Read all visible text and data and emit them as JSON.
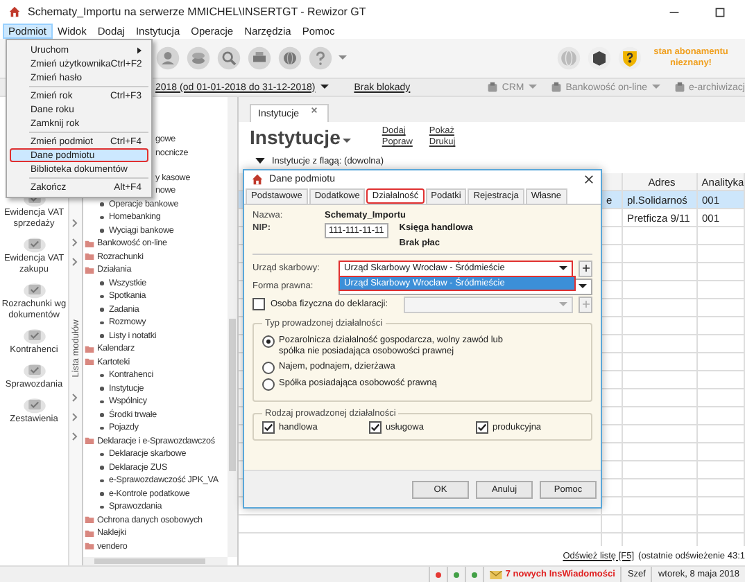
{
  "window": {
    "title": "Schematy_Importu na serwerze MMICHEL\\INSERTGT - Rewizor GT"
  },
  "menu_bar": [
    {
      "label": "Podmiot",
      "selected": true
    },
    {
      "label": "Widok",
      "selected": false
    },
    {
      "label": "Dodaj",
      "selected": false
    },
    {
      "label": "Instytucja",
      "selected": false
    },
    {
      "label": "Operacje",
      "selected": false
    },
    {
      "label": "Narzędzia",
      "selected": false
    },
    {
      "label": "Pomoc",
      "selected": false
    }
  ],
  "podmiot_menu": {
    "items": [
      {
        "kind": "item",
        "label": "Uruchom",
        "submenu": true,
        "selected": false,
        "highlighted": false
      },
      {
        "kind": "item",
        "label": "Zmień użytkownika",
        "shortcut": "Ctrl+F2",
        "submenu": false,
        "selected": false,
        "highlighted": false
      },
      {
        "kind": "item",
        "label": "Zmień hasło",
        "submenu": false,
        "selected": false,
        "highlighted": false
      },
      {
        "kind": "separator"
      },
      {
        "kind": "item",
        "label": "Zmień rok",
        "shortcut": "Ctrl+F3",
        "submenu": false,
        "selected": false,
        "highlighted": false
      },
      {
        "kind": "item",
        "label": "Dane roku",
        "submenu": false,
        "selected": false,
        "highlighted": false
      },
      {
        "kind": "item",
        "label": "Zamknij rok",
        "submenu": false,
        "selected": false,
        "highlighted": false
      },
      {
        "kind": "separator"
      },
      {
        "kind": "item",
        "label": "Zmień podmiot",
        "shortcut": "Ctrl+F4",
        "submenu": false,
        "selected": false,
        "highlighted": false
      },
      {
        "kind": "item",
        "label": "Dane podmiotu",
        "submenu": false,
        "selected": true,
        "highlighted": true
      },
      {
        "kind": "item",
        "label": "Biblioteka dokumentów",
        "submenu": false,
        "selected": false,
        "highlighted": false
      },
      {
        "kind": "separator"
      },
      {
        "kind": "item",
        "label": "Zakończ",
        "shortcut": "Alt+F4",
        "submenu": false,
        "selected": false,
        "highlighted": false
      }
    ]
  },
  "toolbar": {
    "subscription": "stan abonamentu nieznany!"
  },
  "period_bar": {
    "period": "2018 (od 01-01-2018 do 31-12-2018)",
    "lock": "Brak blokady",
    "modules": [
      {
        "label": "CRM",
        "dropdown": true
      },
      {
        "label": "Bankowość on-line",
        "dropdown": true
      },
      {
        "label": "e-archiwizacj",
        "dropdown": false
      }
    ]
  },
  "shortcuts": [
    "Ewidencja VAT sprzedaży",
    "Ewidencja VAT zakupu",
    "Rozrachunki wg dokumentów",
    "Kontrahenci",
    "Sprawozdania",
    "Zestawienia"
  ],
  "module_list_label": "Lista modułów",
  "module_tree": [
    {
      "kind": "partial",
      "label": "gowe"
    },
    {
      "kind": "partial",
      "label": "nocnicze"
    },
    {
      "kind": "partial",
      "label": "y kasowe"
    },
    {
      "kind": "partial",
      "label": "nowe"
    },
    {
      "kind": "leaf",
      "label": "Operacje bankowe"
    },
    {
      "kind": "leaf",
      "label": "Homebanking"
    },
    {
      "kind": "leaf",
      "label": "Wyciągi bankowe"
    },
    {
      "kind": "group",
      "label": "Bankowość on-line"
    },
    {
      "kind": "group",
      "label": "Rozrachunki"
    },
    {
      "kind": "group",
      "label": "Działania",
      "children": [
        {
          "kind": "leaf",
          "label": "Wszystkie"
        },
        {
          "kind": "leaf",
          "label": "Spotkania"
        },
        {
          "kind": "leaf",
          "label": "Zadania"
        },
        {
          "kind": "leaf",
          "label": "Rozmowy"
        },
        {
          "kind": "leaf",
          "label": "Listy i notatki"
        }
      ]
    },
    {
      "kind": "group",
      "label": "Kalendarz"
    },
    {
      "kind": "group",
      "label": "Kartoteki",
      "children": [
        {
          "kind": "leaf",
          "label": "Kontrahenci"
        },
        {
          "kind": "leaf",
          "label": "Instytucje"
        },
        {
          "kind": "leaf",
          "label": "Wspólnicy"
        },
        {
          "kind": "leaf",
          "label": "Środki trwałe"
        },
        {
          "kind": "leaf",
          "label": "Pojazdy"
        }
      ]
    },
    {
      "kind": "group",
      "label": "Deklaracje i e-Sprawozdawczoś",
      "children": [
        {
          "kind": "leaf",
          "label": "Deklaracje skarbowe"
        },
        {
          "kind": "leaf",
          "label": "Deklaracje ZUS"
        },
        {
          "kind": "leaf",
          "label": "e-Sprawozdawczość JPK_VA"
        },
        {
          "kind": "leaf",
          "label": "e-Kontrole podatkowe"
        },
        {
          "kind": "leaf",
          "label": "Sprawozdania"
        }
      ]
    },
    {
      "kind": "group",
      "label": "Ochrona danych osobowych"
    },
    {
      "kind": "group",
      "label": "Naklejki"
    },
    {
      "kind": "group",
      "label": "vendero"
    }
  ],
  "main": {
    "tab": "Instytucje",
    "heading": "Instytucje",
    "actions": [
      "Dodaj",
      "Popraw",
      "Pokaż",
      "Drukuj"
    ],
    "filter": "Instytucje z flagą: (dowolna)",
    "table": {
      "columns": [
        "Adres",
        "Analityka"
      ],
      "rows": [
        {
          "column_1": "e",
          "adres": "pl.Solidarnoś",
          "analityka": "001",
          "selected": true
        },
        {
          "adres": "Pretficza 9/11",
          "analityka": "001",
          "selected": false
        }
      ]
    },
    "refresh_link": "Odśwież listę [F5]",
    "refresh_note": "(ostatnie odświeżenie 43:1"
  },
  "dialog": {
    "title": "Dane podmiotu",
    "tabs": [
      {
        "label": "Podstawowe",
        "selected": false,
        "highlighted": false
      },
      {
        "label": "Dodatkowe",
        "selected": false,
        "highlighted": false
      },
      {
        "label": "Działalność",
        "selected": true,
        "highlighted": true
      },
      {
        "label": "Podatki",
        "selected": false,
        "highlighted": false
      },
      {
        "label": "Rejestracja",
        "selected": false,
        "highlighted": false
      },
      {
        "label": "Własne",
        "selected": false,
        "highlighted": false
      }
    ],
    "name_label": "Nazwa:",
    "name": "Schematy_Importu",
    "nip_label": "NIP:",
    "nip": "111-111-11-11",
    "ledger": "Księga handlowa",
    "payroll": "Brak płac",
    "tax_office": {
      "label": "Urząd skarbowy:",
      "value": "Urząd Skarbowy Wrocław - Śródmieście",
      "highlighted": true,
      "open": true,
      "options": [
        {
          "label": "Urząd Skarbowy Wrocław - Śródmieście",
          "selected": true
        }
      ]
    },
    "legal_form": {
      "label": "Forma prawna:"
    },
    "natural_person": {
      "label": "Osoba fizyczna do deklaracji:",
      "checked": false
    },
    "activity_type": {
      "title": "Typ prowadzonej działalności",
      "options": [
        {
          "label": "Pozarolnicza działalność gospodarcza, wolny zawód lub spółka nie posiadająca osobowości prawnej",
          "selected": true
        },
        {
          "label": "Najem, podnajem, dzierżawa",
          "selected": false
        },
        {
          "label": "Spółka posiadająca osobowość prawną",
          "selected": false
        }
      ]
    },
    "activity_kind": {
      "title": "Rodzaj prowadzonej działalności",
      "options": [
        {
          "label": "handlowa",
          "checked": true
        },
        {
          "label": "usługowa",
          "checked": true
        },
        {
          "label": "produkcyjna",
          "checked": true
        }
      ]
    },
    "buttons": [
      "OK",
      "Anuluj",
      "Pomoc"
    ]
  },
  "status_bar": {
    "indicators": [
      {
        "color": "#e53935"
      },
      {
        "color": "#43a047"
      },
      {
        "color": "#43a047"
      }
    ],
    "messages": "7 nowych InsWiadomości",
    "user": "Szef",
    "date": "wtorek, 8 maja 2018"
  }
}
